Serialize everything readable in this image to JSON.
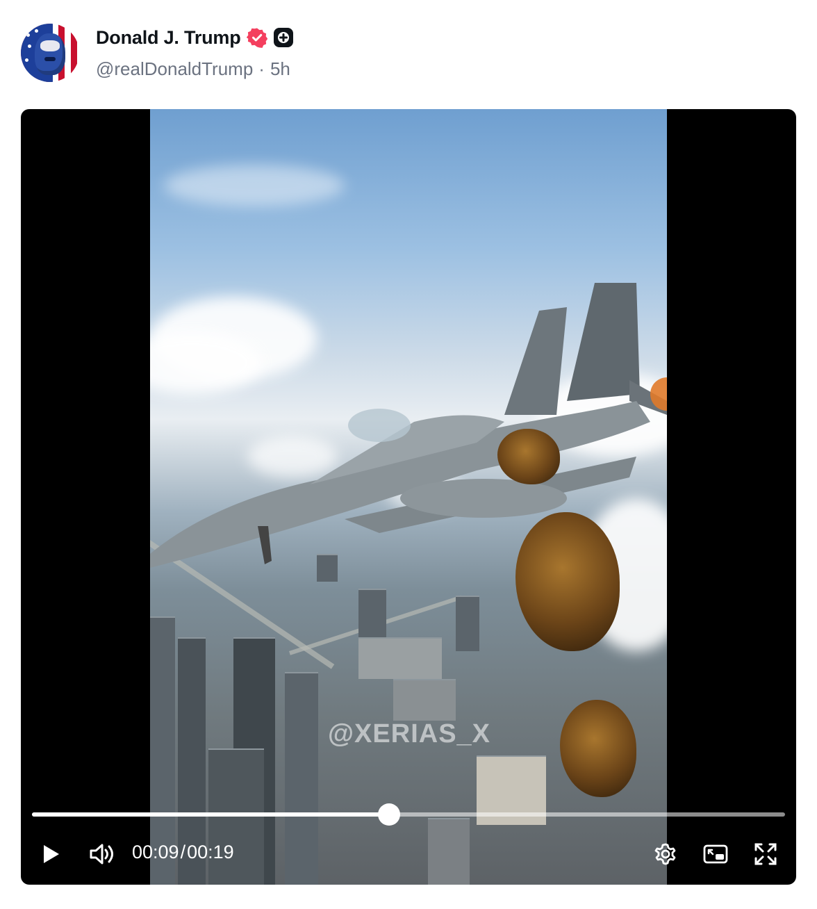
{
  "post": {
    "display_name": "Donald J. Trump",
    "handle": "@realDonaldTrump",
    "separator": "·",
    "time_ago": "5h",
    "verified_color": "#f43f5e"
  },
  "video": {
    "watermark": "@XERIAS_X",
    "current_time": "00:09",
    "time_separator": "/",
    "duration": "00:19",
    "progress": 0.474
  },
  "icons": {
    "verified": "verified-check-icon",
    "badge": "plus-badge-icon",
    "play": "play-icon",
    "volume": "volume-icon",
    "settings": "settings-gear-icon",
    "pip": "picture-in-picture-icon",
    "fullscreen": "fullscreen-icon"
  }
}
